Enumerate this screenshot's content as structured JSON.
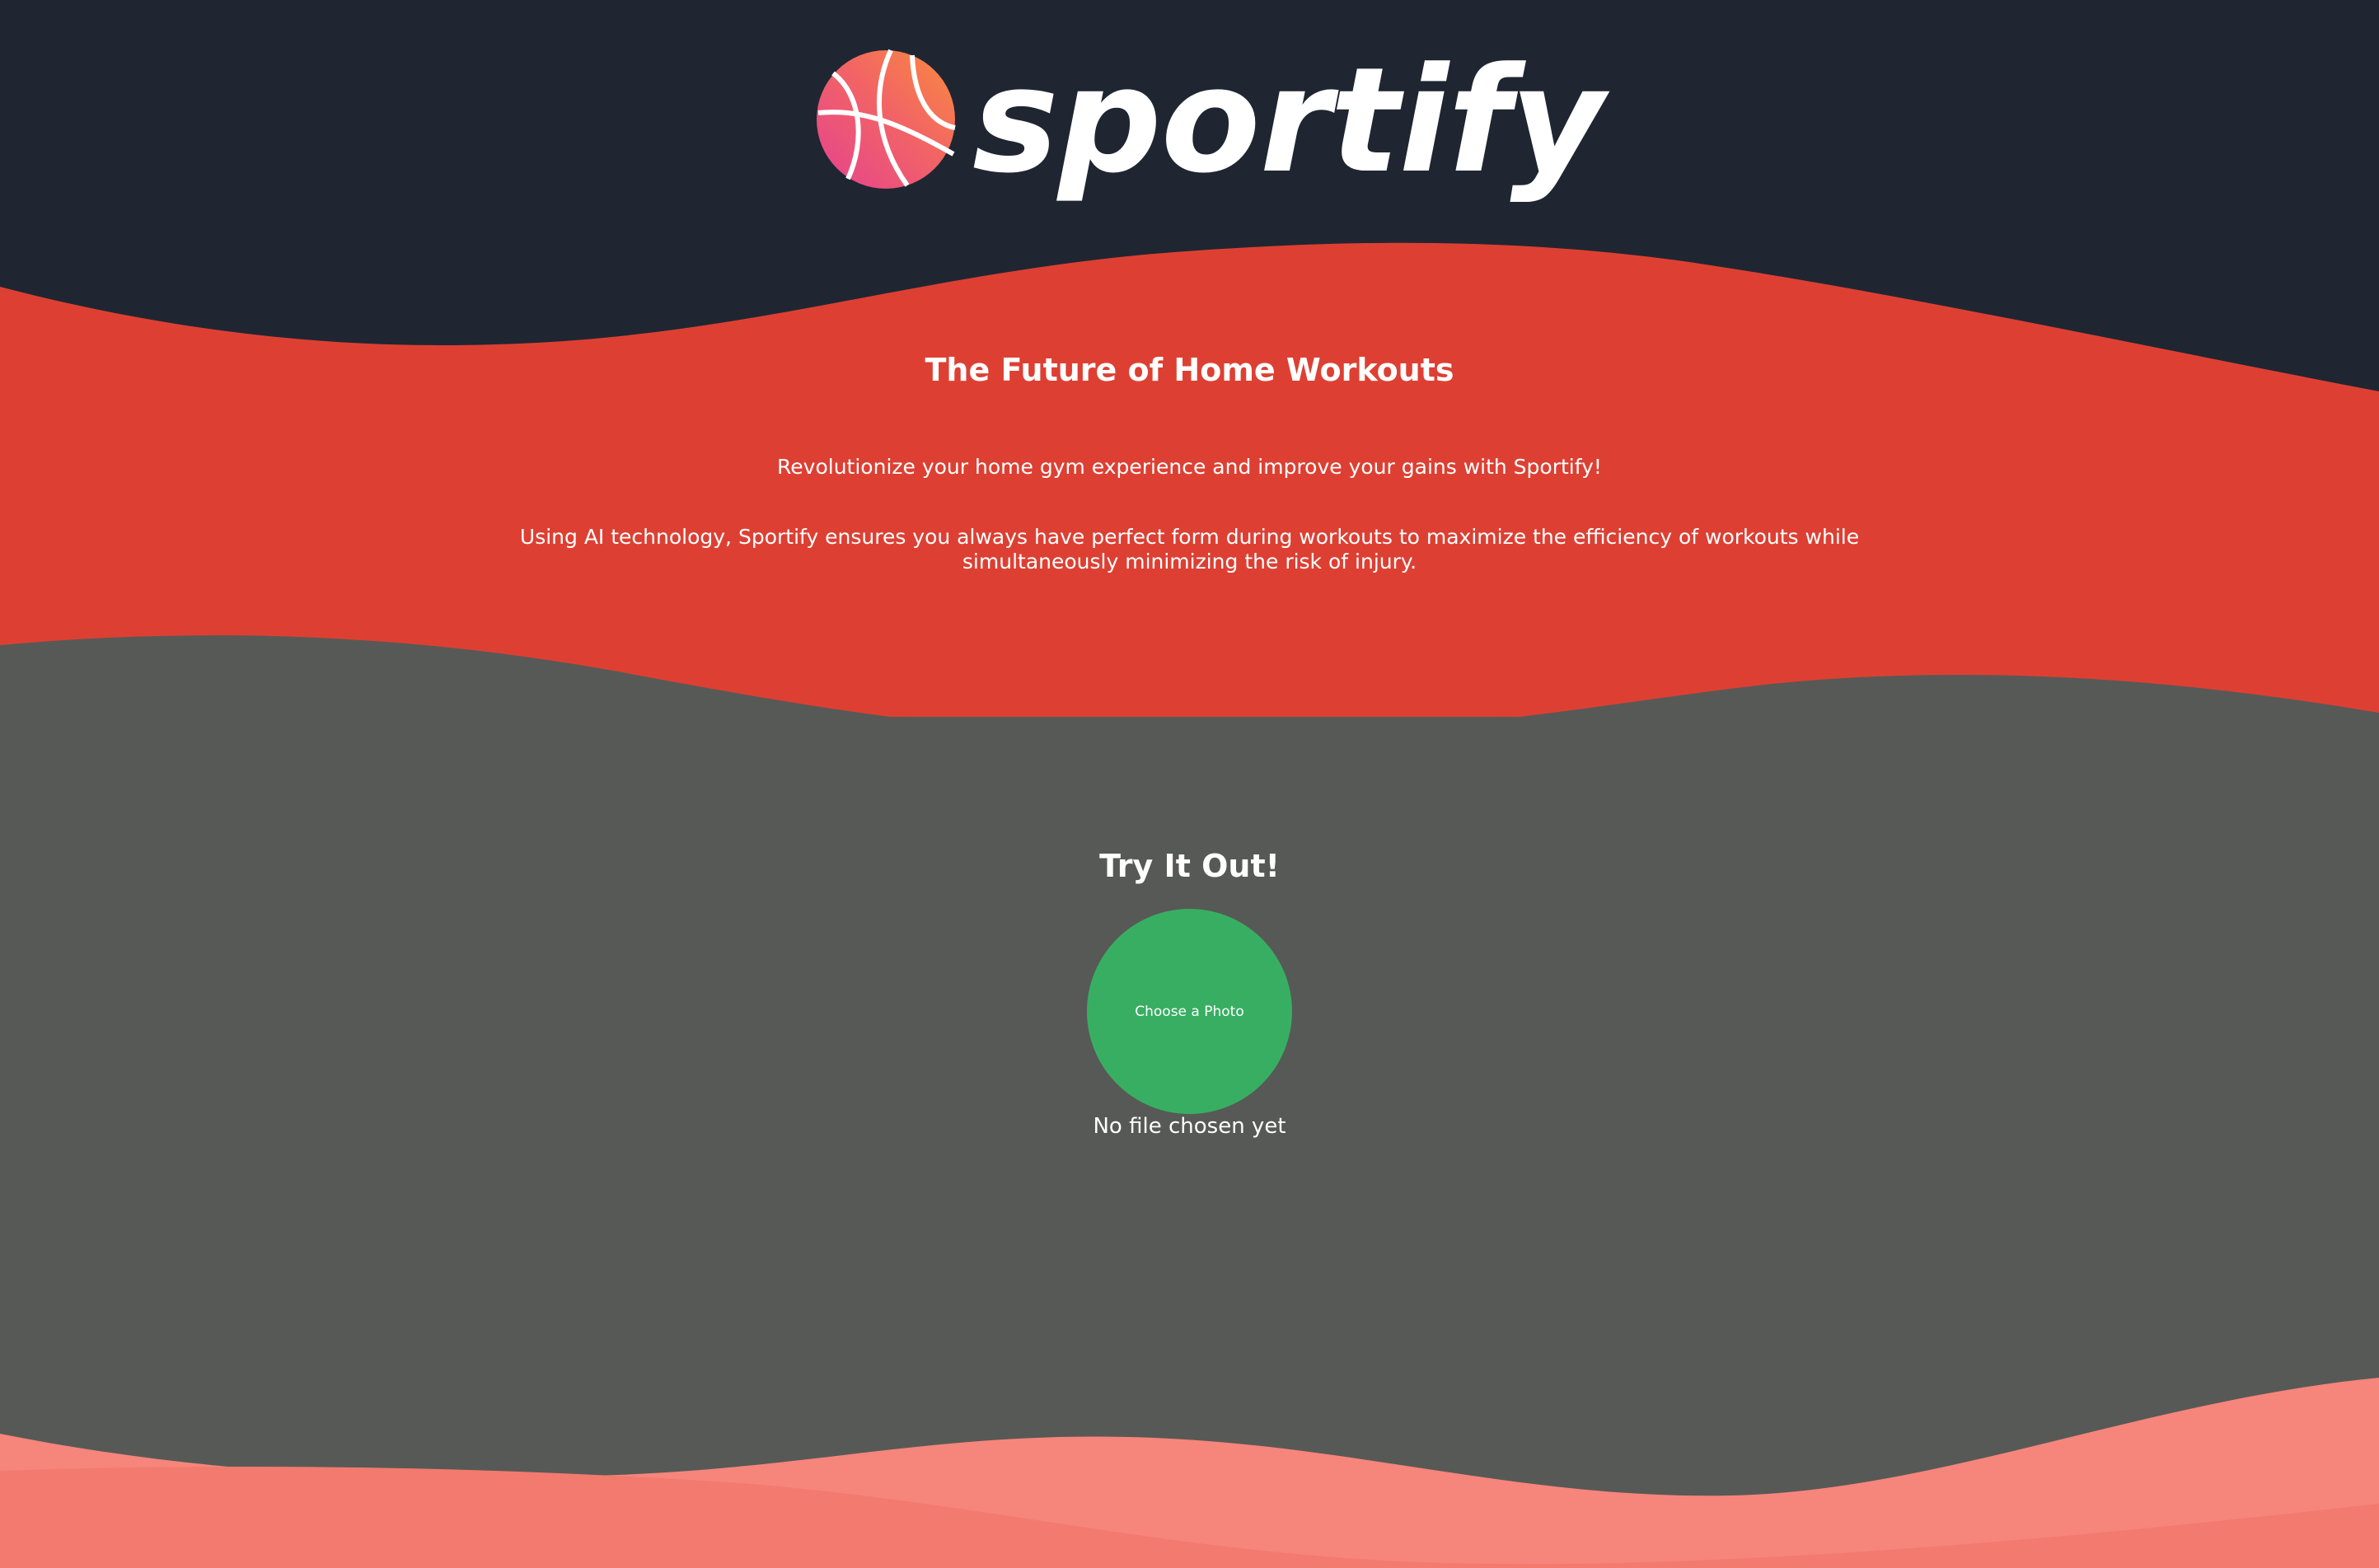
{
  "brand": {
    "name": "sportify",
    "logo_icon": "basketball-icon"
  },
  "hero": {
    "title": "The Future of Home Workouts",
    "subtitle": "Revolutionize your home gym experience and improve your gains with Sportify!",
    "description": "Using AI technology, Sportify ensures you always have perfect form during workouts to maximize the efficiency of workouts while simultaneously minimizing the risk of injury."
  },
  "try_it": {
    "title": "Try It Out!",
    "button_label": "Choose a Photo",
    "file_status": "No file chosen yet"
  },
  "colors": {
    "header_bg": "#1f2631",
    "hero_bg": "#dd4033",
    "main_bg": "#575956",
    "footer_wave": "#f6857b",
    "button": "#38ae62",
    "text": "#ffffff"
  }
}
